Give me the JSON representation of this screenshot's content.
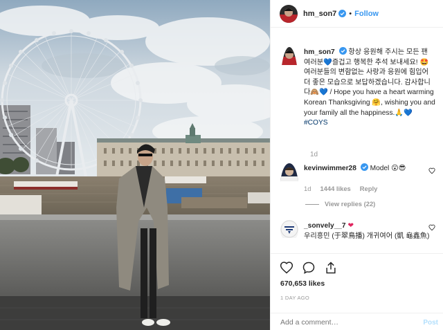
{
  "post": {
    "username": "hm_son7",
    "dot": "•",
    "follow_label": "Follow",
    "caption_korean": "항상 응원해 주시는 모든 팬 여러분",
    "caption_korean_2": "즐겁고 행복한 추석 보내세요!",
    "caption_korean_3": "여러분들의 변함없는 사랑과 응원에 힘입어 더 좋은 모습으로 보답하겠습니다. 감사합니다",
    "caption_english": "/ Hope you have a heart warming Korean Thanksgiving",
    "caption_english_2": ", wishing you and your family all the happiness.",
    "hashtag": "#COYS",
    "time_ago": "1d",
    "likes": "670,653 likes",
    "date": "1 DAY AGO",
    "add_comment_placeholder": "Add a comment…",
    "post_label": "Post"
  },
  "comments": [
    {
      "username": "kevinwimmer28",
      "text": "Model",
      "time": "1d",
      "likes": "1444 likes",
      "reply_label": "Reply",
      "view_replies": "View replies (22)"
    },
    {
      "username": "_sonvely__7",
      "text": "우리흥민 (于翠鳥播) 개귀여어 (凱 龜鑫魚)"
    }
  ],
  "icons": {
    "verified": "verified-badge-icon",
    "heart": "heart-icon",
    "comment": "comment-icon",
    "share": "share-icon",
    "emoji_heart": "blue-heart-emoji"
  },
  "colors": {
    "accent": "#3897f0",
    "verified": "#3897f0",
    "hashtag": "#003569",
    "muted": "#999999",
    "border": "#efefef"
  }
}
